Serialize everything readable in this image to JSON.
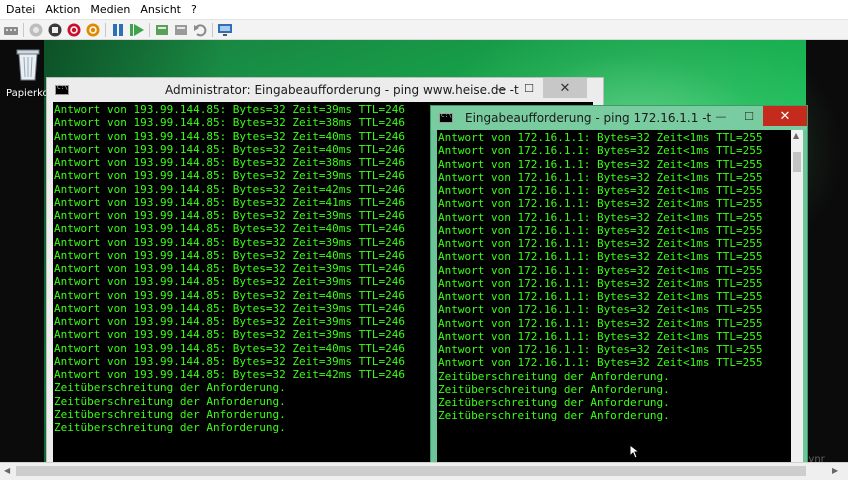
{
  "menu": [
    "Datei",
    "Aktion",
    "Medien",
    "Ansicht",
    "?"
  ],
  "toolbar_icons": [
    "ctrl-alt-del-icon",
    "start-icon",
    "turn-off-icon",
    "shutdown-icon",
    "power-icon",
    "pause-icon",
    "reset-icon",
    "checkpoint-icon",
    "revert-icon",
    "enhanced-session-icon"
  ],
  "desktop": {
    "recycle_bin_label": "Papierkorb",
    "watermark": "www.sexedz-d.wmvnr"
  },
  "window1": {
    "title": "Administrator: Eingabeaufforderung - ping  www.heise.de -t",
    "lines": [
      "Antwort von 193.99.144.85: Bytes=32 Zeit=39ms TTL=246",
      "Antwort von 193.99.144.85: Bytes=32 Zeit=38ms TTL=246",
      "Antwort von 193.99.144.85: Bytes=32 Zeit=40ms TTL=246",
      "Antwort von 193.99.144.85: Bytes=32 Zeit=40ms TTL=246",
      "Antwort von 193.99.144.85: Bytes=32 Zeit=38ms TTL=246",
      "Antwort von 193.99.144.85: Bytes=32 Zeit=39ms TTL=246",
      "Antwort von 193.99.144.85: Bytes=32 Zeit=42ms TTL=246",
      "Antwort von 193.99.144.85: Bytes=32 Zeit=41ms TTL=246",
      "Antwort von 193.99.144.85: Bytes=32 Zeit=39ms TTL=246",
      "Antwort von 193.99.144.85: Bytes=32 Zeit=40ms TTL=246",
      "Antwort von 193.99.144.85: Bytes=32 Zeit=39ms TTL=246",
      "Antwort von 193.99.144.85: Bytes=32 Zeit=40ms TTL=246",
      "Antwort von 193.99.144.85: Bytes=32 Zeit=39ms TTL=246",
      "Antwort von 193.99.144.85: Bytes=32 Zeit=39ms TTL=246",
      "Antwort von 193.99.144.85: Bytes=32 Zeit=40ms TTL=246",
      "Antwort von 193.99.144.85: Bytes=32 Zeit=39ms TTL=246",
      "Antwort von 193.99.144.85: Bytes=32 Zeit=39ms TTL=246",
      "Antwort von 193.99.144.85: Bytes=32 Zeit=39ms TTL=246",
      "Antwort von 193.99.144.85: Bytes=32 Zeit=40ms TTL=246",
      "Antwort von 193.99.144.85: Bytes=32 Zeit=39ms TTL=246",
      "Antwort von 193.99.144.85: Bytes=32 Zeit=42ms TTL=246",
      "Zeitüberschreitung der Anforderung.",
      "Zeitüberschreitung der Anforderung.",
      "Zeitüberschreitung der Anforderung.",
      "Zeitüberschreitung der Anforderung."
    ]
  },
  "window2": {
    "title": "Eingabeaufforderung - ping  172.16.1.1 -t",
    "lines": [
      "Antwort von 172.16.1.1: Bytes=32 Zeit<1ms TTL=255",
      "Antwort von 172.16.1.1: Bytes=32 Zeit<1ms TTL=255",
      "Antwort von 172.16.1.1: Bytes=32 Zeit<1ms TTL=255",
      "Antwort von 172.16.1.1: Bytes=32 Zeit<1ms TTL=255",
      "Antwort von 172.16.1.1: Bytes=32 Zeit<1ms TTL=255",
      "Antwort von 172.16.1.1: Bytes=32 Zeit<1ms TTL=255",
      "Antwort von 172.16.1.1: Bytes=32 Zeit<1ms TTL=255",
      "Antwort von 172.16.1.1: Bytes=32 Zeit<1ms TTL=255",
      "Antwort von 172.16.1.1: Bytes=32 Zeit<1ms TTL=255",
      "Antwort von 172.16.1.1: Bytes=32 Zeit<1ms TTL=255",
      "Antwort von 172.16.1.1: Bytes=32 Zeit<1ms TTL=255",
      "Antwort von 172.16.1.1: Bytes=32 Zeit<1ms TTL=255",
      "Antwort von 172.16.1.1: Bytes=32 Zeit<1ms TTL=255",
      "Antwort von 172.16.1.1: Bytes=32 Zeit<1ms TTL=255",
      "Antwort von 172.16.1.1: Bytes=32 Zeit<1ms TTL=255",
      "Antwort von 172.16.1.1: Bytes=32 Zeit<1ms TTL=255",
      "Antwort von 172.16.1.1: Bytes=32 Zeit<1ms TTL=255",
      "Antwort von 172.16.1.1: Bytes=32 Zeit<1ms TTL=255",
      "Zeitüberschreitung der Anforderung.",
      "Zeitüberschreitung der Anforderung.",
      "Zeitüberschreitung der Anforderung.",
      "Zeitüberschreitung der Anforderung."
    ]
  },
  "colors": {
    "console_text": "#39ff14",
    "console_bg": "#000000",
    "close_button": "#c42b1c",
    "active_frame": "#6cc498"
  }
}
